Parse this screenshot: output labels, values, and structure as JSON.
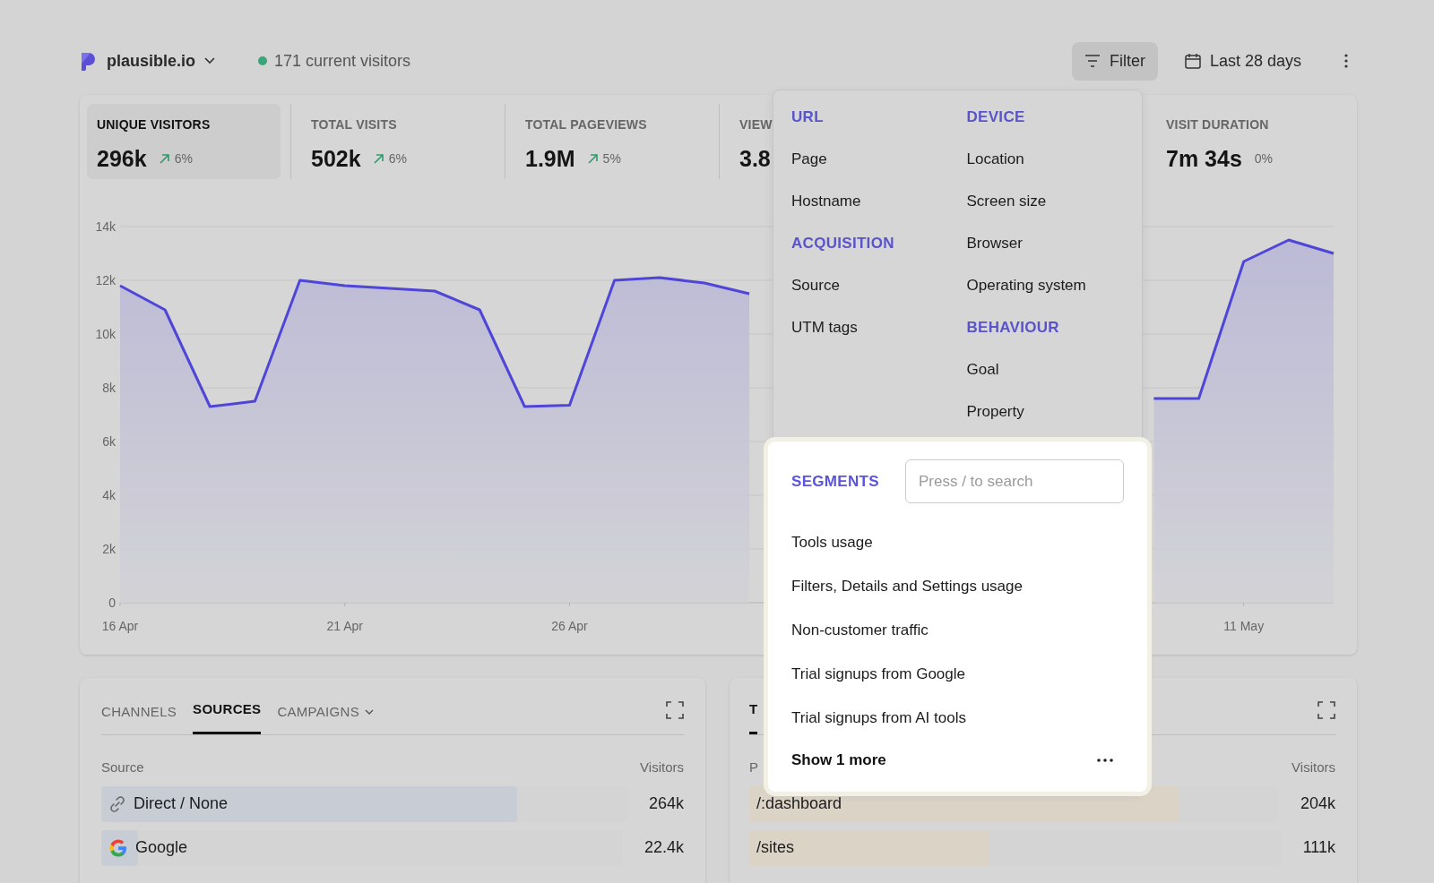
{
  "site": {
    "name": "plausible.io",
    "live": "171 current visitors"
  },
  "toolbar": {
    "filter": {
      "label": "Filter",
      "expanded": true
    },
    "period": "Last 28 days"
  },
  "metrics": [
    {
      "label": "UNIQUE VISITORS",
      "value": "296k",
      "change": "6%",
      "kind": "up",
      "selected": true
    },
    {
      "label": "TOTAL VISITS",
      "value": "502k",
      "change": "6%",
      "kind": "up",
      "selected": false
    },
    {
      "label": "TOTAL PAGEVIEWS",
      "value": "1.9M",
      "change": "5%",
      "kind": "up",
      "selected": false
    },
    {
      "label": "VIEW",
      "value": "3.8",
      "selected": false
    },
    {
      "label": "VISIT DURATION",
      "value": "7m 34s",
      "change": "0%",
      "kind": "flat",
      "selected": false
    }
  ],
  "chart": {
    "chart_data": {
      "type": "area",
      "categories": [
        "16 Apr",
        null,
        null,
        null,
        null,
        "21 Apr",
        null,
        null,
        null,
        null,
        "26 Apr",
        null,
        null,
        null,
        null,
        null,
        null,
        null,
        null,
        null,
        null,
        null,
        null,
        null,
        null,
        "11 May",
        null,
        null
      ],
      "series": [
        {
          "color": "#4f46d8",
          "values": [
            11800,
            10900,
            7300,
            7500,
            12000,
            11800,
            11700,
            11600,
            10900,
            7300,
            7350,
            12000,
            12100,
            11900,
            11500,
            null,
            null,
            null,
            null,
            null,
            null,
            null,
            null,
            7600,
            7600,
            12700,
            13500,
            13000
          ]
        }
      ],
      "ylim": [
        0,
        14000
      ],
      "grid": true,
      "yticks": [
        {
          "value": 0,
          "label": "0"
        },
        {
          "value": 2000,
          "label": "2k"
        },
        {
          "value": 4000,
          "label": "4k"
        },
        {
          "value": 6000,
          "label": "6k"
        },
        {
          "value": 8000,
          "label": "8k"
        },
        {
          "value": 10000,
          "label": "10k"
        },
        {
          "value": 12000,
          "label": "12k"
        },
        {
          "value": 14000,
          "label": "14k"
        }
      ]
    }
  },
  "sources": {
    "tabs": [
      {
        "label": "CHANNELS",
        "selected": false,
        "dropdown": false
      },
      {
        "label": "SOURCES",
        "selected": true,
        "dropdown": false
      },
      {
        "label": "CAMPAIGNS",
        "selected": false,
        "dropdown": true
      }
    ],
    "columns": [
      "Source",
      "Visitors"
    ],
    "rows": [
      {
        "name": "Direct / None",
        "kind": "link",
        "visitors": "264k",
        "level": 0.79
      },
      {
        "name": "Google",
        "kind": "google",
        "visitors": "22.4k",
        "level": 0.07
      }
    ]
  },
  "pages": {
    "tabs": [
      {
        "label": "T",
        "selected": true
      }
    ],
    "columns": [
      "P",
      "Visitors"
    ],
    "rows": [
      {
        "name": "/:dashboard",
        "visitors": "204k",
        "level": 0.81
      },
      {
        "name": "/sites",
        "visitors": "111k",
        "level": 0.45
      }
    ]
  },
  "filter_menu": {
    "columns": [
      [
        {
          "heading": "URL",
          "items": [
            "Page",
            "Hostname"
          ]
        },
        {
          "heading": "ACQUISITION",
          "items": [
            "Source",
            "UTM tags"
          ]
        }
      ],
      [
        {
          "heading": "DEVICE",
          "items": [
            "Location",
            "Screen size",
            "Browser",
            "Operating system"
          ]
        },
        {
          "heading": "BEHAVIOUR",
          "items": [
            "Goal",
            "Property"
          ]
        }
      ]
    ],
    "segments": {
      "heading": "SEGMENTS",
      "search": {
        "placeholder": "Press / to search"
      },
      "items": [
        "Tools usage",
        "Filters, Details and Settings usage",
        "Non-customer traffic",
        "Trial signups from Google",
        "Trial signups from AI tools"
      ],
      "show_more": "Show 1 more"
    }
  }
}
